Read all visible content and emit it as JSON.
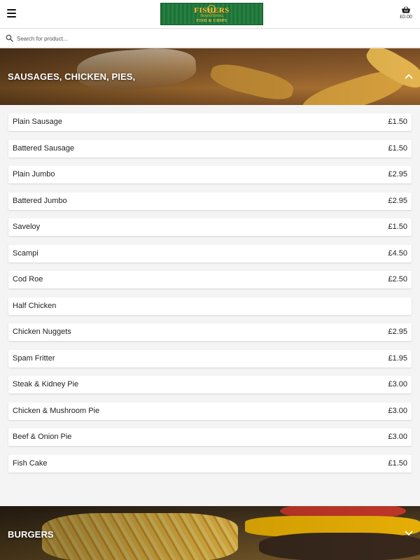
{
  "header": {
    "logo": {
      "name": "FISHERS",
      "subtitle": "TRADITIONAL",
      "tagline": "FISH & CHIPS"
    },
    "basket_total": "£0.00"
  },
  "search": {
    "placeholder": "Search for product..."
  },
  "categories": [
    {
      "title": "SAUSAGES, CHICKEN, PIES,",
      "expanded": true,
      "items": [
        {
          "name": "Plain Sausage",
          "price": "£1.50"
        },
        {
          "name": "Battered Sausage",
          "price": "£1.50"
        },
        {
          "name": "Plain Jumbo",
          "price": "£2.95"
        },
        {
          "name": "Battered Jumbo",
          "price": "£2.95"
        },
        {
          "name": "Saveloy",
          "price": "£1.50"
        },
        {
          "name": "Scampi",
          "price": "£4.50"
        },
        {
          "name": "Cod Roe",
          "price": "£2.50"
        },
        {
          "name": "Half Chicken",
          "price": ""
        },
        {
          "name": "Chicken Nuggets",
          "price": "£2.95"
        },
        {
          "name": "Spam Fritter",
          "price": "£1.95"
        },
        {
          "name": "Steak & Kidney Pie",
          "price": "£3.00"
        },
        {
          "name": "Chicken & Mushroom Pie",
          "price": "£3.00"
        },
        {
          "name": "Beef & Onion Pie",
          "price": "£3.00"
        },
        {
          "name": "Fish Cake",
          "price": "£1.50"
        }
      ]
    },
    {
      "title": "BURGERS",
      "expanded": false
    }
  ],
  "icons": {
    "menu": "hamburger-menu-icon",
    "basket": "basket-icon",
    "search": "search-icon",
    "collapse": "chevron-up-icon",
    "expand": "chevron-down-icon"
  },
  "colors": {
    "logo_background": "#1f7a3a",
    "logo_text": "#f3c43f"
  }
}
